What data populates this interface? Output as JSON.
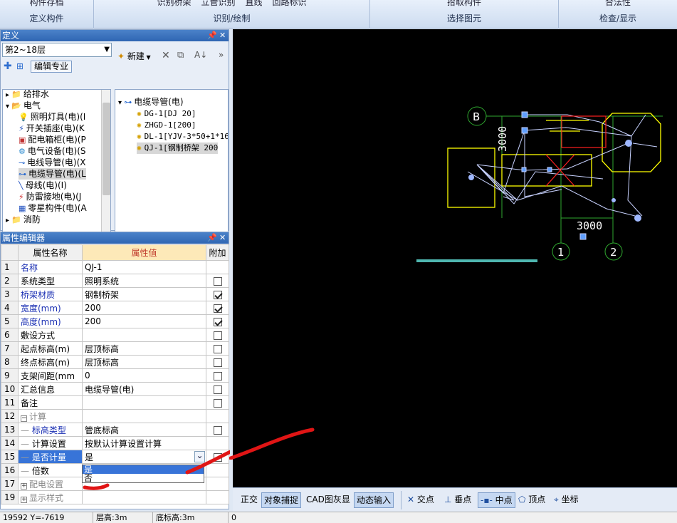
{
  "ribbon": {
    "groups": [
      {
        "label": "定义构件",
        "tools": [
          "构件存档"
        ]
      },
      {
        "label": "识别/绘制",
        "tools": [
          "识别桥架",
          "立管识别",
          "直线",
          "回路标识"
        ]
      },
      {
        "label": "选择图元",
        "tools": [
          "拾取构件"
        ]
      },
      {
        "label": "检查/显示",
        "tools": [
          "合法性"
        ]
      }
    ]
  },
  "define_panel": {
    "title": "定义",
    "floor": "第2~18层",
    "edit_specialty": "编辑专业",
    "new_button": "新建",
    "left_tree": [
      {
        "label": "给排水",
        "icon": "folder-icon",
        "level": 1
      },
      {
        "label": "电气",
        "icon": "folder-open-icon",
        "level": 1
      },
      {
        "label": "照明灯具(电)(I",
        "icon": "bulb-icon",
        "level": 2
      },
      {
        "label": "开关插座(电)(K",
        "icon": "switch-icon",
        "level": 2
      },
      {
        "label": "配电箱柜(电)(P",
        "icon": "panel-box-icon",
        "level": 2
      },
      {
        "label": "电气设备(电)(S",
        "icon": "device-icon",
        "level": 2
      },
      {
        "label": "电线导管(电)(X",
        "icon": "wire-conduit-icon",
        "level": 2
      },
      {
        "label": "电缆导管(电)(L",
        "icon": "cable-conduit-icon",
        "level": 2,
        "selected": true
      },
      {
        "label": "母线(电)(I)",
        "icon": "busbar-icon",
        "level": 2
      },
      {
        "label": "防雷接地(电)(J",
        "icon": "lightning-icon",
        "level": 2
      },
      {
        "label": "零星构件(电)(A",
        "icon": "grid-parts-icon",
        "level": 2
      },
      {
        "label": "消防",
        "icon": "folder-icon",
        "level": 1
      }
    ],
    "right_tree": {
      "root": "电缆导管(电)",
      "items": [
        "DG-1[DJ 20]",
        "ZHGD-1[200]",
        "DL-1[YJV-3*50+1*16",
        "QJ-1[钢制桥架 200"
      ]
    }
  },
  "property_editor": {
    "title": "属性编辑器",
    "headers": {
      "name": "属性名称",
      "value": "属性值",
      "extra": "附加"
    },
    "rows": [
      {
        "no": "1",
        "name": "名称",
        "value": "QJ-1",
        "style": "blue",
        "check": "none"
      },
      {
        "no": "2",
        "name": "系统类型",
        "value": "照明系统",
        "style": "normal",
        "check": "off"
      },
      {
        "no": "3",
        "name": "桥架材质",
        "value": "钢制桥架",
        "style": "blue",
        "check": "on"
      },
      {
        "no": "4",
        "name": "宽度(mm)",
        "value": "200",
        "style": "blue",
        "check": "on"
      },
      {
        "no": "5",
        "name": "高度(mm)",
        "value": "200",
        "style": "blue",
        "check": "on"
      },
      {
        "no": "6",
        "name": "敷设方式",
        "value": "",
        "style": "normal",
        "check": "off"
      },
      {
        "no": "7",
        "name": "起点标高(m)",
        "value": "层顶标高",
        "style": "normal",
        "check": "off"
      },
      {
        "no": "8",
        "name": "终点标高(m)",
        "value": "层顶标高",
        "style": "normal",
        "check": "off"
      },
      {
        "no": "9",
        "name": "支架间距(mm",
        "value": "0",
        "style": "normal",
        "check": "off"
      },
      {
        "no": "10",
        "name": "汇总信息",
        "value": "电缆导管(电)",
        "style": "normal",
        "check": "off"
      },
      {
        "no": "11",
        "name": "备注",
        "value": "",
        "style": "normal",
        "check": "off"
      },
      {
        "no": "12",
        "name": "计算",
        "value": "",
        "style": "group-open",
        "check": "none"
      },
      {
        "no": "13",
        "name": "标高类型",
        "value": "管底标高",
        "style": "child-blue",
        "check": "off"
      },
      {
        "no": "14",
        "name": "计算设置",
        "value": "按默认计算设置计算",
        "style": "child",
        "check": "none"
      },
      {
        "no": "15",
        "name": "是否计量",
        "value": "是",
        "style": "child-selected",
        "check": "off"
      },
      {
        "no": "16",
        "name": "倍数",
        "value": "",
        "style": "child",
        "check": "none"
      },
      {
        "no": "17",
        "name": "配电设置",
        "value": "",
        "style": "group-closed",
        "check": "none"
      },
      {
        "no": "19",
        "name": "显示样式",
        "value": "",
        "style": "group-closed",
        "check": "none"
      }
    ],
    "dropdown_options": [
      "是",
      "否"
    ]
  },
  "cad": {
    "axis_labels": {
      "b": "B",
      "one": "1",
      "two": "2"
    },
    "dimensions": {
      "vertical": "3000",
      "horizontal": "3000"
    },
    "colors": {
      "background": "#000000",
      "axis": "#2fa82f",
      "equipment": "#ffff00",
      "cable": "#c8d2ff",
      "highlight": "#ff2020",
      "ground": "#4fb7b0"
    }
  },
  "snap_toolbar": {
    "buttons": [
      {
        "label": "正交",
        "on": false
      },
      {
        "label": "对象捕捉",
        "on": true
      },
      {
        "label": "CAD图灰显",
        "on": false
      },
      {
        "label": "动态输入",
        "on": true
      }
    ],
    "snaps": [
      {
        "label": "交点",
        "icon": "intersection-icon"
      },
      {
        "label": "垂点",
        "icon": "perpendicular-icon"
      },
      {
        "label": "中点",
        "icon": "midpoint-icon"
      },
      {
        "label": "顶点",
        "icon": "vertex-icon"
      },
      {
        "label": "坐标",
        "icon": "coordinate-icon"
      }
    ]
  },
  "status_bar": {
    "coords": "19592 Y=-7619",
    "floor_height": "层高:3m",
    "base_elevation": "底标高:3m",
    "extra": "0"
  }
}
